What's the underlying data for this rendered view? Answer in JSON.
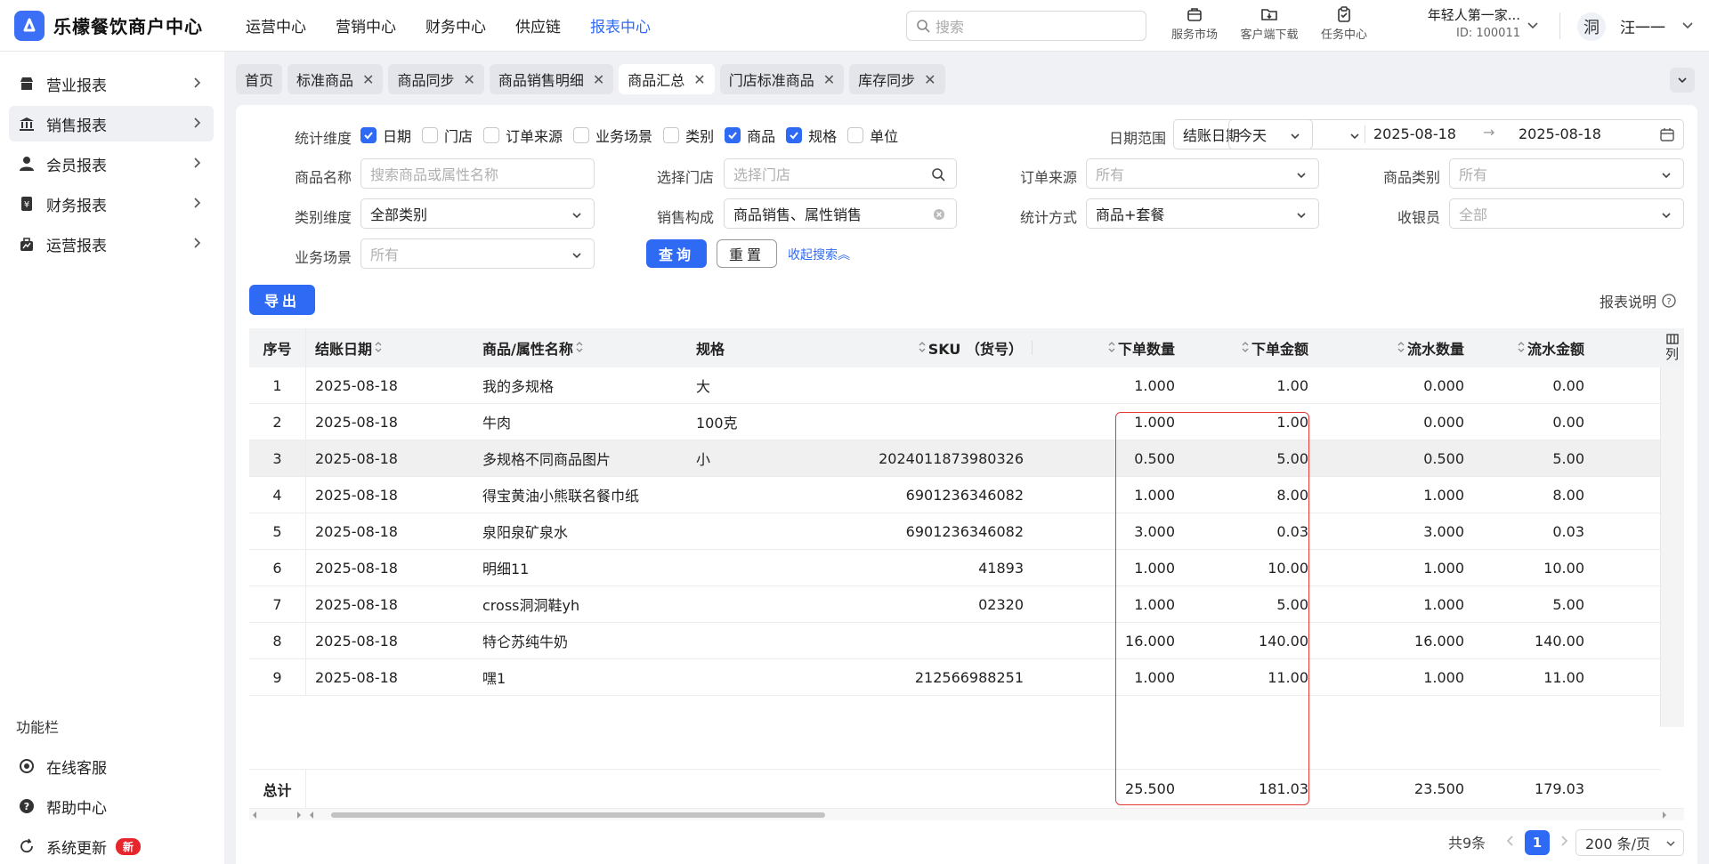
{
  "app": {
    "brand": "乐檬餐饮商户中心"
  },
  "topnav": [
    "运营中心",
    "营销中心",
    "财务中心",
    "供应链",
    "报表中心"
  ],
  "search": {
    "placeholder": "搜索"
  },
  "topicons": [
    "服务市场",
    "客户端下载",
    "任务中心"
  ],
  "shop": {
    "name": "年轻人第一家...",
    "id": "ID: 100011"
  },
  "user": {
    "name": "汪一一",
    "avatar_text": "洞"
  },
  "sidebar": {
    "items": [
      "营业报表",
      "销售报表",
      "会员报表",
      "财务报表",
      "运营报表"
    ],
    "func_title": "功能栏",
    "func_items": [
      "在线客服",
      "帮助中心",
      "系统更新"
    ],
    "new_badge": "新"
  },
  "tabs": [
    "首页",
    "标准商品",
    "商品同步",
    "商品销售明细",
    "商品汇总",
    "门店标准商品",
    "库存同步"
  ],
  "filters": {
    "dim_label": "统计维度",
    "dims": [
      {
        "label": "日期",
        "checked": true
      },
      {
        "label": "门店",
        "checked": false
      },
      {
        "label": "订单来源",
        "checked": false
      },
      {
        "label": "业务场景",
        "checked": false
      },
      {
        "label": "类别",
        "checked": false
      },
      {
        "label": "商品",
        "checked": true
      },
      {
        "label": "规格",
        "checked": true
      },
      {
        "label": "单位",
        "checked": false
      }
    ],
    "date_range_label": "日期范围",
    "date_type": "结账日期",
    "date_preset": "今天",
    "date_start": "2025-08-18",
    "date_end": "2025-08-18",
    "product_name_label": "商品名称",
    "product_name_ph": "搜索商品或属性名称",
    "store_label": "选择门店",
    "store_ph": "选择门店",
    "order_src_label": "订单来源",
    "order_src_value": "所有",
    "category_label": "商品类别",
    "category_value": "所有",
    "cat_dim_label": "类别维度",
    "cat_dim_value": "全部类别",
    "sales_comp_label": "销售构成",
    "sales_comp_value": "商品销售、属性销售",
    "stat_mode_label": "统计方式",
    "stat_mode_value": "商品+套餐",
    "cashier_label": "收银员",
    "cashier_value": "全部",
    "scene_label": "业务场景",
    "scene_value": "所有",
    "query": "查询",
    "reset": "重置",
    "collapse": "收起搜索"
  },
  "export": "导出",
  "report_help": "报表说明",
  "table": {
    "headers": [
      "序号",
      "结账日期",
      "商品/属性名称",
      "规格",
      "SKU （货号）",
      "下单数量",
      "下单金额",
      "流水数量",
      "流水金额"
    ],
    "rows": [
      [
        "1",
        "2025-08-18",
        "我的多规格",
        "大",
        "",
        "1.000",
        "1.00",
        "0.000",
        "0.00"
      ],
      [
        "2",
        "2025-08-18",
        "牛肉",
        "100克",
        "",
        "1.000",
        "1.00",
        "0.000",
        "0.00"
      ],
      [
        "3",
        "2025-08-18",
        "多规格不同商品图片",
        "小",
        "2024011873980326",
        "0.500",
        "5.00",
        "0.500",
        "5.00"
      ],
      [
        "4",
        "2025-08-18",
        "得宝黄油小熊联名餐巾纸",
        "",
        "6901236346082",
        "1.000",
        "8.00",
        "1.000",
        "8.00"
      ],
      [
        "5",
        "2025-08-18",
        "泉阳泉矿泉水",
        "",
        "6901236346082",
        "3.000",
        "0.03",
        "3.000",
        "0.03"
      ],
      [
        "6",
        "2025-08-18",
        "明细11",
        "",
        "41893",
        "1.000",
        "10.00",
        "1.000",
        "10.00"
      ],
      [
        "7",
        "2025-08-18",
        "cross洞洞鞋yh",
        "",
        "02320",
        "1.000",
        "5.00",
        "1.000",
        "5.00"
      ],
      [
        "8",
        "2025-08-18",
        "特仑苏纯牛奶",
        "",
        "",
        "16.000",
        "140.00",
        "16.000",
        "140.00"
      ],
      [
        "9",
        "2025-08-18",
        "嘿1",
        "",
        "212566988251",
        "1.000",
        "11.00",
        "1.000",
        "11.00"
      ]
    ],
    "total": [
      "总计",
      "",
      "",
      "",
      "",
      "25.500",
      "181.03",
      "23.500",
      "179.03"
    ],
    "colset_label": "列"
  },
  "pager": {
    "total_text": "共9条",
    "current": "1",
    "page_size": "200 条/页"
  },
  "colors": {
    "accent": "#2f6af5",
    "highlight_border": "#e53935"
  }
}
